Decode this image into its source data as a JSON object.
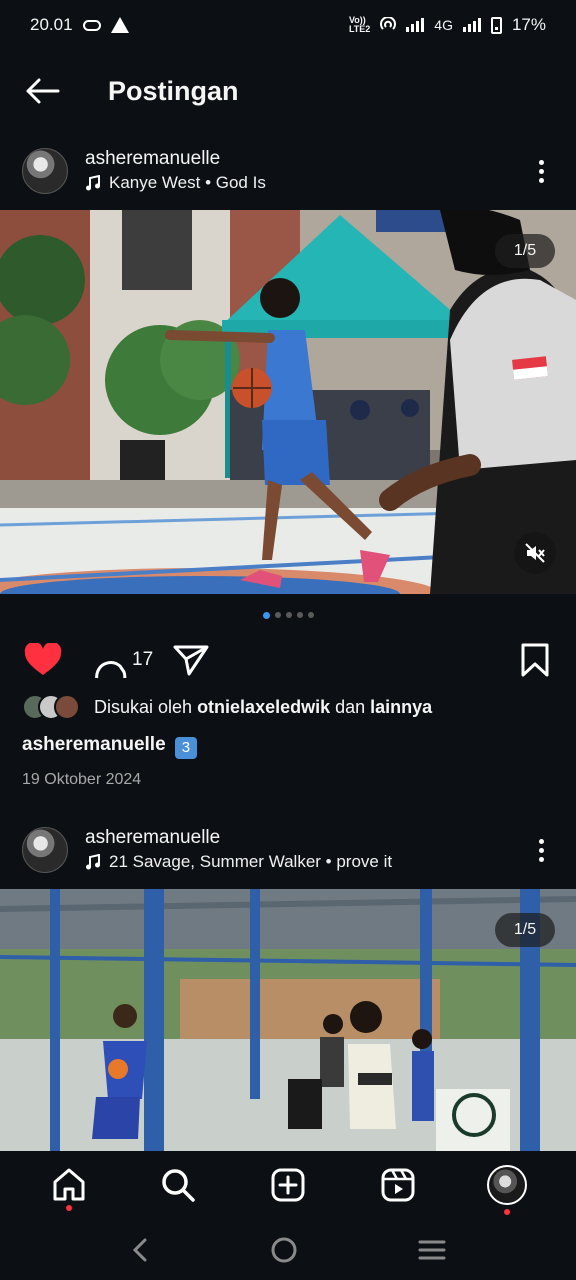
{
  "status": {
    "time": "20.01",
    "volte_top": "Vo)) ",
    "volte_bottom": "LTE2",
    "network": "4G",
    "battery": "17%"
  },
  "header": {
    "title": "Postingan"
  },
  "post1": {
    "username": "asheremanuelle",
    "music": "Kanye West • God Is",
    "counter": "1/5",
    "comments": "17",
    "liked_by_prefix": "Disukai oleh ",
    "liked_by_user": "otnielaxeledwik",
    "liked_by_middle": " dan ",
    "liked_by_others": "lainnya",
    "caption_user": "asheremanuelle",
    "caption_emoji": "3",
    "date": "19 Oktober 2024"
  },
  "post2": {
    "username": "asheremanuelle",
    "music": "21 Savage, Summer Walker • prove it",
    "counter": "1/5"
  },
  "icons": {
    "back": "arrow-left-icon",
    "more": "more-vertical-icon",
    "music": "music-note-icon",
    "like": "heart-filled-icon",
    "comment": "comment-icon",
    "share": "send-icon",
    "save": "bookmark-icon",
    "mute": "speaker-muted-icon",
    "nav": [
      "home-icon",
      "search-icon",
      "create-icon",
      "reels-icon",
      "profile-avatar"
    ]
  },
  "colors": {
    "background": "#0c1014",
    "like": "#ff3040",
    "dot_active": "#3897f0"
  }
}
